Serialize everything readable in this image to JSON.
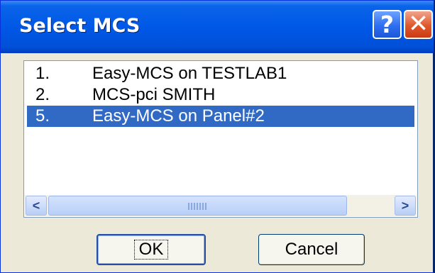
{
  "window": {
    "title": "Select MCS"
  },
  "titlebar_buttons": {
    "help": "?",
    "close": "✕"
  },
  "list": {
    "items": [
      {
        "num": "1.",
        "text": "Easy-MCS on TESTLAB1",
        "selected": false
      },
      {
        "num": "2.",
        "text": "MCS-pci SMITH",
        "selected": false
      },
      {
        "num": "5.",
        "text": "Easy-MCS on Panel#2",
        "selected": true
      }
    ]
  },
  "scrollbar": {
    "left_arrow": "<",
    "right_arrow": ">",
    "left_icon": "chevron-left-icon",
    "right_icon": "chevron-right-icon"
  },
  "buttons": {
    "ok": "OK",
    "cancel": "Cancel"
  },
  "colors": {
    "titlebar": "#0058e6",
    "selection": "#316ac5",
    "dialog_bg": "#ece9d8"
  }
}
